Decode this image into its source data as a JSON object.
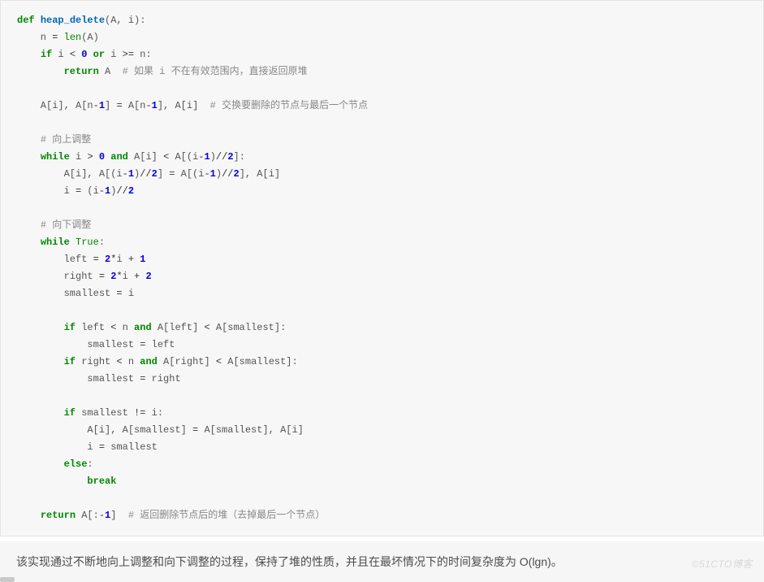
{
  "code_tokens": [
    [
      {
        "t": "def ",
        "c": "kw"
      },
      {
        "t": "heap_delete",
        "c": "fn"
      },
      {
        "t": "(A, i):",
        "c": ""
      }
    ],
    [
      {
        "t": "    n ",
        "c": ""
      },
      {
        "t": "=",
        "c": "op"
      },
      {
        "t": " ",
        "c": ""
      },
      {
        "t": "len",
        "c": "bi"
      },
      {
        "t": "(A)",
        "c": ""
      }
    ],
    [
      {
        "t": "    ",
        "c": ""
      },
      {
        "t": "if",
        "c": "kw"
      },
      {
        "t": " i ",
        "c": ""
      },
      {
        "t": "<",
        "c": "op"
      },
      {
        "t": " ",
        "c": ""
      },
      {
        "t": "0",
        "c": "num"
      },
      {
        "t": " ",
        "c": ""
      },
      {
        "t": "or",
        "c": "kw"
      },
      {
        "t": " i ",
        "c": ""
      },
      {
        "t": ">=",
        "c": "op"
      },
      {
        "t": " n:",
        "c": ""
      }
    ],
    [
      {
        "t": "        ",
        "c": ""
      },
      {
        "t": "return",
        "c": "kw"
      },
      {
        "t": " A  ",
        "c": ""
      },
      {
        "t": "# 如果 i 不在有效范围内，直接返回原堆",
        "c": "cm"
      }
    ],
    [
      {
        "t": "",
        "c": ""
      }
    ],
    [
      {
        "t": "    A[i], A[n",
        "c": ""
      },
      {
        "t": "-",
        "c": "op"
      },
      {
        "t": "1",
        "c": "num"
      },
      {
        "t": "] ",
        "c": ""
      },
      {
        "t": "=",
        "c": "op"
      },
      {
        "t": " A[n",
        "c": ""
      },
      {
        "t": "-",
        "c": "op"
      },
      {
        "t": "1",
        "c": "num"
      },
      {
        "t": "], A[i]  ",
        "c": ""
      },
      {
        "t": "# 交换要删除的节点与最后一个节点",
        "c": "cm"
      }
    ],
    [
      {
        "t": "",
        "c": ""
      }
    ],
    [
      {
        "t": "    ",
        "c": ""
      },
      {
        "t": "# 向上调整",
        "c": "cm"
      }
    ],
    [
      {
        "t": "    ",
        "c": ""
      },
      {
        "t": "while",
        "c": "kw"
      },
      {
        "t": " i ",
        "c": ""
      },
      {
        "t": ">",
        "c": "op"
      },
      {
        "t": " ",
        "c": ""
      },
      {
        "t": "0",
        "c": "num"
      },
      {
        "t": " ",
        "c": ""
      },
      {
        "t": "and",
        "c": "kw"
      },
      {
        "t": " A[i] ",
        "c": ""
      },
      {
        "t": "<",
        "c": "op"
      },
      {
        "t": " A[(i",
        "c": ""
      },
      {
        "t": "-",
        "c": "op"
      },
      {
        "t": "1",
        "c": "num"
      },
      {
        "t": ")",
        "c": ""
      },
      {
        "t": "//",
        "c": "op"
      },
      {
        "t": "2",
        "c": "num"
      },
      {
        "t": "]:",
        "c": ""
      }
    ],
    [
      {
        "t": "        A[i], A[(i",
        "c": ""
      },
      {
        "t": "-",
        "c": "op"
      },
      {
        "t": "1",
        "c": "num"
      },
      {
        "t": ")",
        "c": ""
      },
      {
        "t": "//",
        "c": "op"
      },
      {
        "t": "2",
        "c": "num"
      },
      {
        "t": "] ",
        "c": ""
      },
      {
        "t": "=",
        "c": "op"
      },
      {
        "t": " A[(i",
        "c": ""
      },
      {
        "t": "-",
        "c": "op"
      },
      {
        "t": "1",
        "c": "num"
      },
      {
        "t": ")",
        "c": ""
      },
      {
        "t": "//",
        "c": "op"
      },
      {
        "t": "2",
        "c": "num"
      },
      {
        "t": "], A[i]",
        "c": ""
      }
    ],
    [
      {
        "t": "        i ",
        "c": ""
      },
      {
        "t": "=",
        "c": "op"
      },
      {
        "t": " (i",
        "c": ""
      },
      {
        "t": "-",
        "c": "op"
      },
      {
        "t": "1",
        "c": "num"
      },
      {
        "t": ")",
        "c": ""
      },
      {
        "t": "//",
        "c": "op"
      },
      {
        "t": "2",
        "c": "num"
      }
    ],
    [
      {
        "t": "",
        "c": ""
      }
    ],
    [
      {
        "t": "    ",
        "c": ""
      },
      {
        "t": "# 向下调整",
        "c": "cm"
      }
    ],
    [
      {
        "t": "    ",
        "c": ""
      },
      {
        "t": "while",
        "c": "kw"
      },
      {
        "t": " ",
        "c": ""
      },
      {
        "t": "True",
        "c": "bi"
      },
      {
        "t": ":",
        "c": ""
      }
    ],
    [
      {
        "t": "        left ",
        "c": ""
      },
      {
        "t": "=",
        "c": "op"
      },
      {
        "t": " ",
        "c": ""
      },
      {
        "t": "2",
        "c": "num"
      },
      {
        "t": "*",
        "c": "op"
      },
      {
        "t": "i ",
        "c": ""
      },
      {
        "t": "+",
        "c": "op"
      },
      {
        "t": " ",
        "c": ""
      },
      {
        "t": "1",
        "c": "num"
      }
    ],
    [
      {
        "t": "        right ",
        "c": ""
      },
      {
        "t": "=",
        "c": "op"
      },
      {
        "t": " ",
        "c": ""
      },
      {
        "t": "2",
        "c": "num"
      },
      {
        "t": "*",
        "c": "op"
      },
      {
        "t": "i ",
        "c": ""
      },
      {
        "t": "+",
        "c": "op"
      },
      {
        "t": " ",
        "c": ""
      },
      {
        "t": "2",
        "c": "num"
      }
    ],
    [
      {
        "t": "        smallest ",
        "c": ""
      },
      {
        "t": "=",
        "c": "op"
      },
      {
        "t": " i",
        "c": ""
      }
    ],
    [
      {
        "t": "",
        "c": ""
      }
    ],
    [
      {
        "t": "        ",
        "c": ""
      },
      {
        "t": "if",
        "c": "kw"
      },
      {
        "t": " left ",
        "c": ""
      },
      {
        "t": "<",
        "c": "op"
      },
      {
        "t": " n ",
        "c": ""
      },
      {
        "t": "and",
        "c": "kw"
      },
      {
        "t": " A[left] ",
        "c": ""
      },
      {
        "t": "<",
        "c": "op"
      },
      {
        "t": " A[smallest]:",
        "c": ""
      }
    ],
    [
      {
        "t": "            smallest ",
        "c": ""
      },
      {
        "t": "=",
        "c": "op"
      },
      {
        "t": " left",
        "c": ""
      }
    ],
    [
      {
        "t": "        ",
        "c": ""
      },
      {
        "t": "if",
        "c": "kw"
      },
      {
        "t": " right ",
        "c": ""
      },
      {
        "t": "<",
        "c": "op"
      },
      {
        "t": " n ",
        "c": ""
      },
      {
        "t": "and",
        "c": "kw"
      },
      {
        "t": " A[right] ",
        "c": ""
      },
      {
        "t": "<",
        "c": "op"
      },
      {
        "t": " A[smallest]:",
        "c": ""
      }
    ],
    [
      {
        "t": "            smallest ",
        "c": ""
      },
      {
        "t": "=",
        "c": "op"
      },
      {
        "t": " right",
        "c": ""
      }
    ],
    [
      {
        "t": "",
        "c": ""
      }
    ],
    [
      {
        "t": "        ",
        "c": ""
      },
      {
        "t": "if",
        "c": "kw"
      },
      {
        "t": " smallest ",
        "c": ""
      },
      {
        "t": "!=",
        "c": "op"
      },
      {
        "t": " i:",
        "c": ""
      }
    ],
    [
      {
        "t": "            A[i], A[smallest] ",
        "c": ""
      },
      {
        "t": "=",
        "c": "op"
      },
      {
        "t": " A[smallest], A[i]",
        "c": ""
      }
    ],
    [
      {
        "t": "            i ",
        "c": ""
      },
      {
        "t": "=",
        "c": "op"
      },
      {
        "t": " smallest",
        "c": ""
      }
    ],
    [
      {
        "t": "        ",
        "c": ""
      },
      {
        "t": "else",
        "c": "kw"
      },
      {
        "t": ":",
        "c": ""
      }
    ],
    [
      {
        "t": "            ",
        "c": ""
      },
      {
        "t": "break",
        "c": "kw"
      }
    ],
    [
      {
        "t": "",
        "c": ""
      }
    ],
    [
      {
        "t": "    ",
        "c": ""
      },
      {
        "t": "return",
        "c": "kw"
      },
      {
        "t": " A[:",
        "c": ""
      },
      {
        "t": "-",
        "c": "op"
      },
      {
        "t": "1",
        "c": "num"
      },
      {
        "t": "]  ",
        "c": ""
      },
      {
        "t": "# 返回删除节点后的堆（去掉最后一个节点）",
        "c": "cm"
      }
    ]
  ],
  "explanation": "该实现通过不断地向上调整和向下调整的过程，保持了堆的性质，并且在最坏情况下的时间复杂度为 O(lgn)。",
  "watermark": "©51CTO博客"
}
